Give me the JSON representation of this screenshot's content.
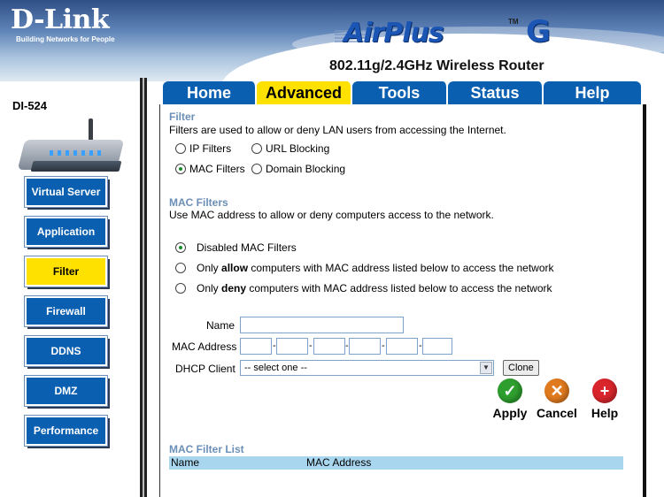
{
  "brand": {
    "logo": "D-Link",
    "tagline": "Building Networks for People",
    "product": "AirPlus",
    "product_suffix": "G",
    "trademark": "TM"
  },
  "header": {
    "subtitle": "802.11g/2.4GHz Wireless Router"
  },
  "sidebar": {
    "model": "DI-524",
    "items": [
      {
        "label": "Virtual Server"
      },
      {
        "label": "Application"
      },
      {
        "label": "Filter",
        "active": true
      },
      {
        "label": "Firewall"
      },
      {
        "label": "DDNS"
      },
      {
        "label": "DMZ"
      },
      {
        "label": "Performance"
      }
    ]
  },
  "tabs": [
    {
      "label": "Home"
    },
    {
      "label": "Advanced",
      "active": true
    },
    {
      "label": "Tools"
    },
    {
      "label": "Status"
    },
    {
      "label": "Help"
    }
  ],
  "filter": {
    "title": "Filter",
    "description": "Filters are used to allow or deny LAN users from accessing the Internet.",
    "options": [
      {
        "label": "IP Filters",
        "selected": false
      },
      {
        "label": "URL Blocking",
        "selected": false
      },
      {
        "label": "MAC Filters",
        "selected": true
      },
      {
        "label": "Domain Blocking",
        "selected": false
      }
    ]
  },
  "mac_filters": {
    "title": "MAC Filters",
    "description": "Use MAC address to allow or deny computers access to the network.",
    "opt_disabled": "Disabled MAC Filters",
    "opt_allow": {
      "pre": "Only ",
      "bold": "allow",
      "post": " computers with MAC address listed below to access the network"
    },
    "opt_deny": {
      "pre": "Only ",
      "bold": "deny",
      "post": " computers with MAC address listed below to access the network"
    },
    "selected_option": "disabled"
  },
  "form": {
    "name_label": "Name",
    "name_value": "",
    "mac_label": "MAC Address",
    "mac_octets": [
      "",
      "",
      "",
      "",
      "",
      ""
    ],
    "mac_separator": "-",
    "dhcp_label": "DHCP Client",
    "dhcp_selected": "-- select one --",
    "clone_label": "Clone"
  },
  "actions": {
    "apply": "Apply",
    "cancel": "Cancel",
    "help": "Help"
  },
  "list": {
    "title": "MAC Filter List",
    "col_name": "Name",
    "col_mac": "MAC Address"
  },
  "colors": {
    "tab_blue": "#0a5fb0",
    "active_yellow": "#ffe100",
    "section_title": "#6b8fb7",
    "list_header": "#a9d6ef"
  }
}
